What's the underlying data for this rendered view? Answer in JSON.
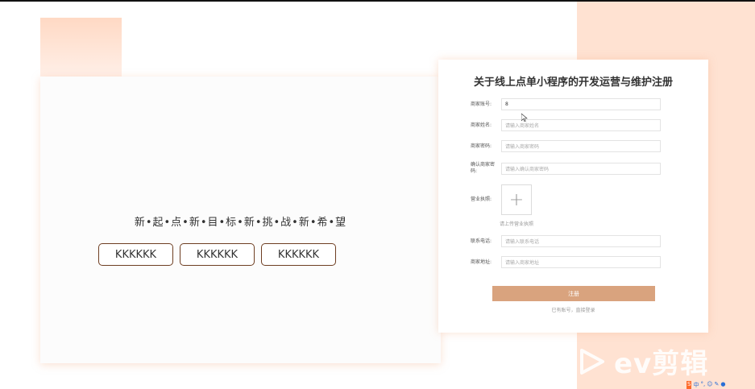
{
  "left": {
    "slogan": "新•起•点•新•目•标•新•挑•战•新•希•望",
    "buttons": [
      "KKKKKK",
      "KKKKKK",
      "KKKKKK"
    ]
  },
  "form": {
    "title": "关于线上点单小程序的开发运营与维护注册",
    "fields": {
      "account": {
        "label": "商家账号:",
        "value": "8"
      },
      "name": {
        "label": "商家姓名:",
        "placeholder": "请输入商家姓名"
      },
      "password": {
        "label": "商家密码:",
        "placeholder": "请输入商家密码"
      },
      "confirm": {
        "label": "确认商家密码:",
        "placeholder": "请输入确认商家密码"
      },
      "license": {
        "label": "营业执照:",
        "hint": "请上传营业执照"
      },
      "phone": {
        "label": "联系电话:",
        "placeholder": "请输入联系电话"
      },
      "address": {
        "label": "商家地址:",
        "placeholder": "请输入商家地址"
      }
    },
    "submit": "注册",
    "login_link": "已有账号，直接登录"
  },
  "watermark": {
    "text": "ev剪辑"
  },
  "tray": {
    "ime": "中"
  },
  "colors": {
    "accent": "#d9a37e",
    "peach": "#ffe2d2",
    "button_border": "#6e3e22"
  }
}
